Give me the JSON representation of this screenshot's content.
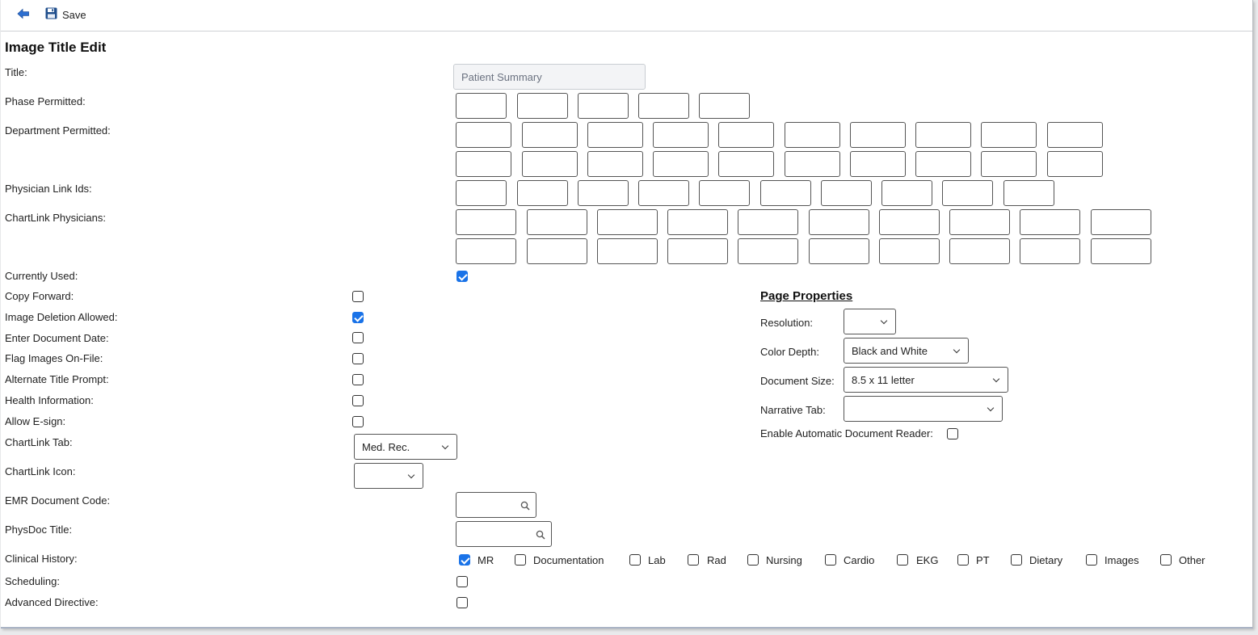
{
  "toolbar": {
    "save_label": "Save"
  },
  "page_title": "Image Title Edit",
  "labels": {
    "title": "Title:",
    "phase_permitted": "Phase Permitted:",
    "department_permitted": "Department Permitted:",
    "physician_link_ids": "Physician Link Ids:",
    "chartlink_physicians": "ChartLink Physicians:",
    "currently_used": "Currently Used:",
    "copy_forward": "Copy Forward:",
    "image_deletion_allowed": "Image Deletion Allowed:",
    "enter_document_date": "Enter Document Date:",
    "flag_images_on_file": "Flag Images On-File:",
    "alternate_title_prompt": "Alternate Title Prompt:",
    "health_information": "Health Information:",
    "allow_esign": "Allow E-sign:",
    "chartlink_tab": "ChartLink Tab:",
    "chartlink_icon": "ChartLink Icon:",
    "emr_document_code": "EMR Document Code:",
    "physdoc_title": "PhysDoc Title:",
    "clinical_history": "Clinical History:",
    "scheduling": "Scheduling:",
    "advanced_directive": "Advanced Directive:"
  },
  "fields": {
    "title_value": "Patient Summary",
    "chartlink_tab_value": "Med. Rec.",
    "chartlink_icon_value": "",
    "emr_document_code_value": "",
    "physdoc_title_value": ""
  },
  "checkboxes": {
    "currently_used": true,
    "copy_forward": false,
    "image_deletion_allowed": true,
    "enter_document_date": false,
    "flag_images_on_file": false,
    "alternate_title_prompt": false,
    "health_information": false,
    "allow_esign": false,
    "scheduling": false,
    "advanced_directive": false
  },
  "clinical_history": [
    {
      "label": "MR",
      "checked": true
    },
    {
      "label": "Documentation",
      "checked": false
    },
    {
      "label": "Lab",
      "checked": false
    },
    {
      "label": "Rad",
      "checked": false
    },
    {
      "label": "Nursing",
      "checked": false
    },
    {
      "label": "Cardio",
      "checked": false
    },
    {
      "label": "EKG",
      "checked": false
    },
    {
      "label": "PT",
      "checked": false
    },
    {
      "label": "Dietary",
      "checked": false
    },
    {
      "label": "Images",
      "checked": false
    },
    {
      "label": "Other",
      "checked": false
    }
  ],
  "page_properties": {
    "heading": "Page Properties",
    "resolution_label": "Resolution:",
    "resolution_value": "",
    "color_depth_label": "Color Depth:",
    "color_depth_value": "Black and White",
    "document_size_label": "Document Size:",
    "document_size_value": "8.5 x 11 letter",
    "narrative_tab_label": "Narrative Tab:",
    "narrative_tab_value": "",
    "enable_reader_label": "Enable Automatic Document Reader:",
    "enable_reader_checked": false
  },
  "icons": {
    "back": "back-arrow-icon",
    "save": "floppy-disk-icon",
    "search": "magnifier-icon"
  },
  "colors": {
    "accent": "#1a73e8",
    "back_icon": "#2d6fd0",
    "save_icon": "#1f4e8c"
  }
}
